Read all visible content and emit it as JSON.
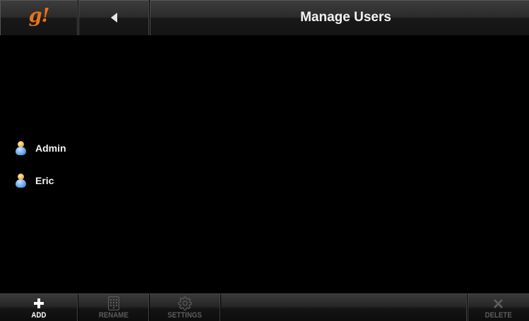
{
  "header": {
    "logo_text": "g!",
    "title": "Manage Users"
  },
  "users": [
    {
      "name": "Admin"
    },
    {
      "name": "Eric"
    }
  ],
  "toolbar": {
    "add_label": "ADD",
    "rename_label": "RENAME",
    "settings_label": "SETTINGS",
    "delete_label": "DELETE"
  },
  "colors": {
    "accent": "#e8731c",
    "background": "#000000",
    "text": "#f2f2f2",
    "disabled_text": "#5c5c5c"
  },
  "icons": {
    "logo": "g-logo-icon",
    "back": "back-arrow-icon",
    "user": "user-icon",
    "add": "plus-icon",
    "rename": "keypad-icon",
    "settings": "gear-icon",
    "delete": "x-icon"
  }
}
